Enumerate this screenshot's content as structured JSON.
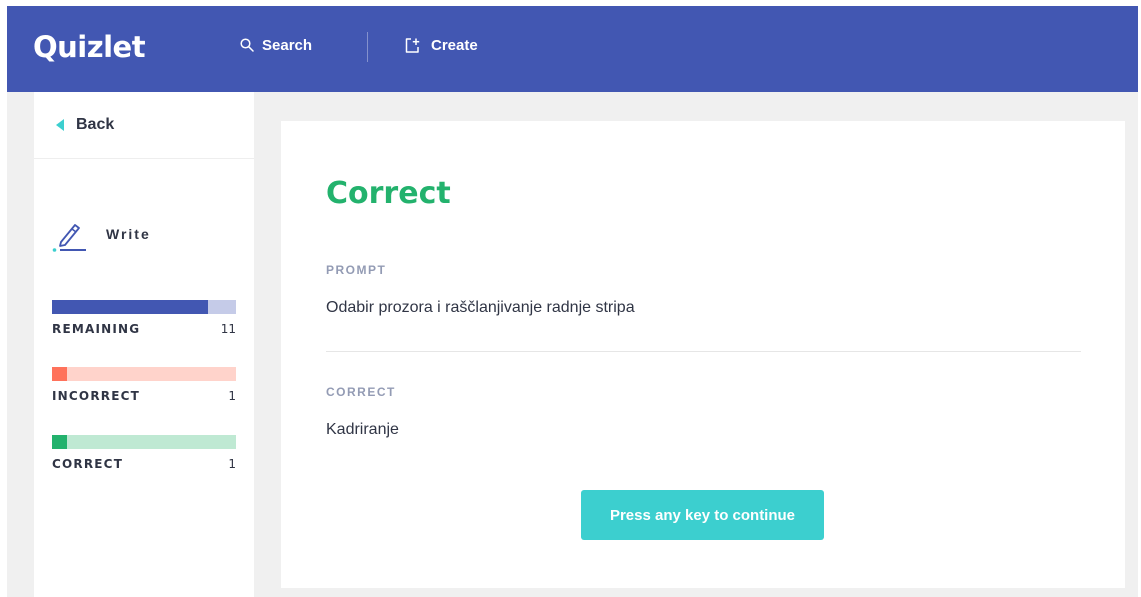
{
  "header": {
    "logo": "Quizlet",
    "search_label": "Search",
    "create_label": "Create"
  },
  "sidebar": {
    "back_label": "Back",
    "mode_label": "Write",
    "stats": [
      {
        "label": "REMAINING",
        "count": "11",
        "progress": 0.85,
        "fill_color": "#4257b2",
        "track_color": "#c5cbe8"
      },
      {
        "label": "INCORRECT",
        "count": "1",
        "progress": 0.08,
        "fill_color": "#ff725b",
        "track_color": "#ffd3cb"
      },
      {
        "label": "CORRECT",
        "count": "1",
        "progress": 0.08,
        "fill_color": "#23b26d",
        "track_color": "#bfe9d3"
      }
    ]
  },
  "card": {
    "result_title": "Correct",
    "prompt_label": "PROMPT",
    "prompt_text": "Odabir prozora i raščlanjivanje radnje stripa",
    "answer_label": "CORRECT",
    "answer_text": "Kadriranje",
    "continue_label": "Press any key to continue"
  },
  "colors": {
    "brand": "#4257b2",
    "correct": "#23b26d",
    "incorrect": "#ff725b",
    "button": "#3ccfcf",
    "background": "#f0f0f0"
  },
  "icons": {
    "search": "search-icon",
    "create": "create-set-icon",
    "back": "back-triangle-icon",
    "write": "pen-write-icon"
  }
}
